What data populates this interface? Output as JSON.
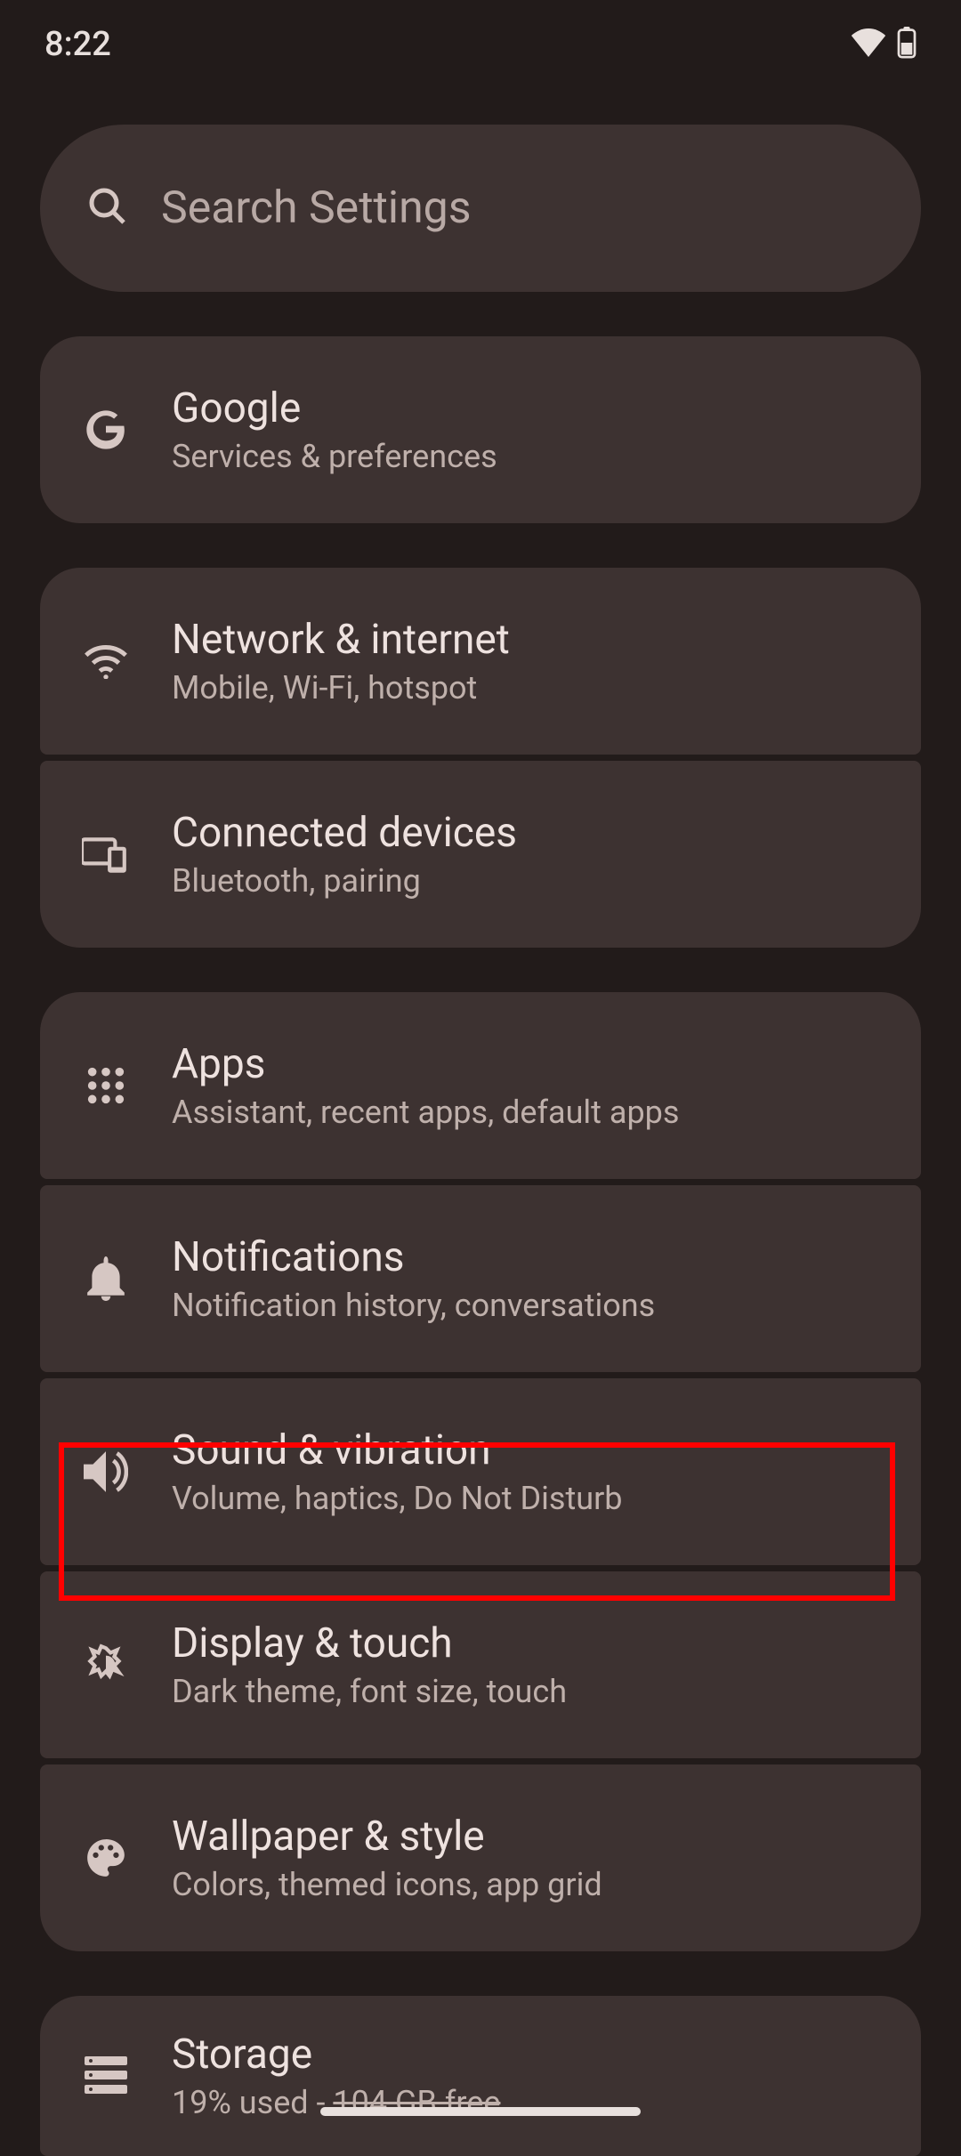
{
  "status_bar": {
    "time": "8:22"
  },
  "search": {
    "placeholder": "Search Settings"
  },
  "google": {
    "title": "Google",
    "subtitle": "Services & preferences"
  },
  "items": [
    {
      "title": "Network & internet",
      "subtitle": "Mobile, Wi-Fi, hotspot"
    },
    {
      "title": "Connected devices",
      "subtitle": "Bluetooth, pairing"
    },
    {
      "title": "Apps",
      "subtitle": "Assistant, recent apps, default apps"
    },
    {
      "title": "Notifications",
      "subtitle": "Notification history, conversations"
    },
    {
      "title": "Sound & vibration",
      "subtitle": "Volume, haptics, Do Not Disturb"
    },
    {
      "title": "Display & touch",
      "subtitle": "Dark theme, font size, touch"
    },
    {
      "title": "Wallpaper & style",
      "subtitle": "Colors, themed icons, app grid"
    },
    {
      "title": "Storage",
      "subtitle_prefix": "19% used - ",
      "subtitle_strike": "104 GB free"
    }
  ]
}
